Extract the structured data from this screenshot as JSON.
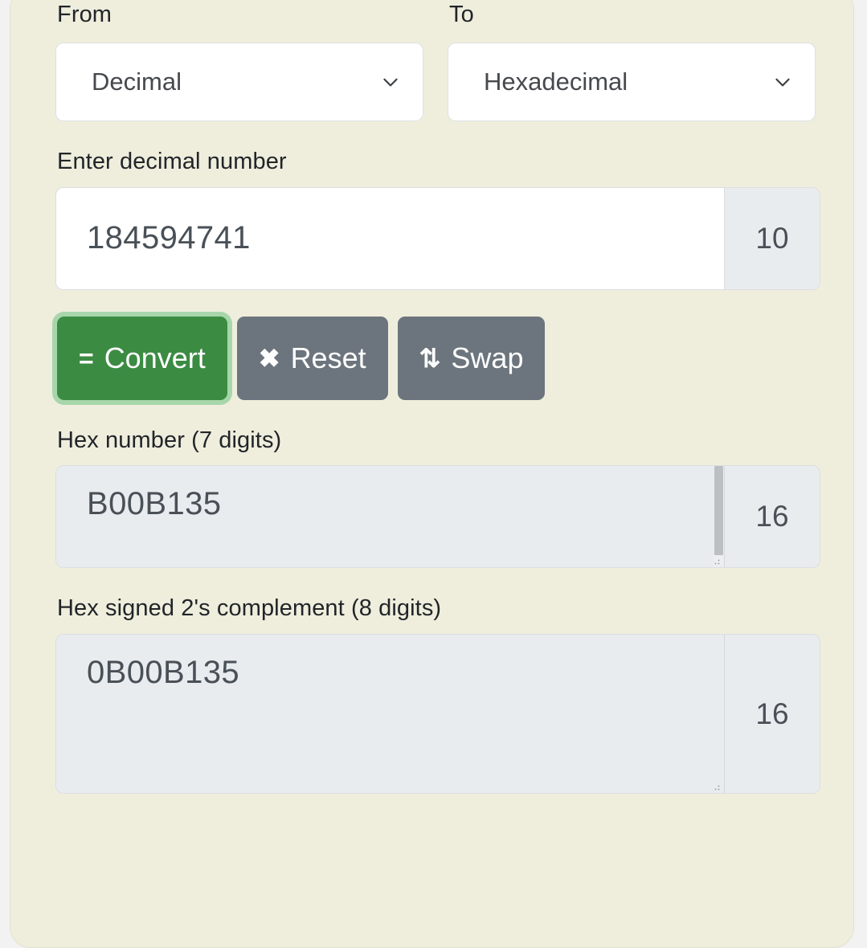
{
  "converter": {
    "from": {
      "label": "From",
      "selected": "Decimal",
      "chevron_icon": "chevron-down-icon"
    },
    "to": {
      "label": "To",
      "selected": "Hexadecimal",
      "chevron_icon": "chevron-down-icon"
    },
    "input": {
      "label": "Enter decimal number",
      "value": "184594741",
      "base": "10"
    },
    "buttons": [
      {
        "name": "convert",
        "icon": "=",
        "icon_name": "equals-icon",
        "label": "Convert",
        "style": "primary",
        "focused": true
      },
      {
        "name": "reset",
        "icon": "✖",
        "icon_name": "close-x-icon",
        "label": "Reset",
        "style": "secondary",
        "focused": false
      },
      {
        "name": "swap",
        "icon": "⇅",
        "icon_name": "swap-arrows-icon",
        "label": "Swap",
        "style": "secondary",
        "focused": false
      }
    ],
    "outputs": [
      {
        "name": "hex-number",
        "label": "Hex number (7 digits)",
        "value": "B00B135",
        "base": "16",
        "has_scrollbar": true
      },
      {
        "name": "hex-signed-twos-complement",
        "label": "Hex signed 2's complement (8 digits)",
        "value": "0B00B135",
        "base": "16",
        "has_scrollbar": false
      }
    ]
  },
  "colors": {
    "card_background": "#efeedd",
    "page_background": "#f2f2f2",
    "primary_button": "#3c8b43",
    "primary_focus_ring": "#a8d6ab",
    "secondary_button": "#6c757d",
    "readonly_field": "#e9ecef",
    "label_text": "#212529",
    "value_text": "#495057"
  }
}
